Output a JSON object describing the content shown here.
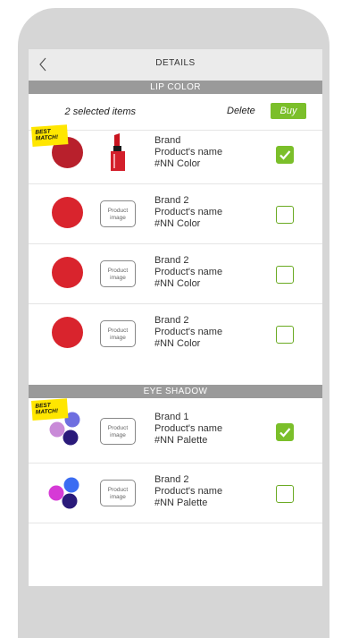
{
  "nav": {
    "title": "DETAILS",
    "back_icon": "chevron-left-icon"
  },
  "toolbar": {
    "selected_count": "2 selected items",
    "delete_label": "Delete",
    "buy_label": "Buy"
  },
  "colors": {
    "accent_green": "#7bbf2a",
    "badge_yellow": "#ffe600",
    "section_gray": "#9a9a9a"
  },
  "sections": [
    {
      "title": "LIP COLOR",
      "items": [
        {
          "best_match": "BEST MATCH!",
          "brand": "Brand",
          "product": "Product's name",
          "color": "#NN Color",
          "swatch": "#b8202c",
          "image_label": "",
          "has_lipstick": true,
          "checked": true
        },
        {
          "best_match": "",
          "brand": "Brand 2",
          "product": "Product's name",
          "color": "#NN Color",
          "swatch": "#d9242d",
          "image_label": "Product image",
          "has_lipstick": false,
          "checked": false
        },
        {
          "best_match": "",
          "brand": "Brand 2",
          "product": "Product's name",
          "color": "#NN Color",
          "swatch": "#d9242d",
          "image_label": "Product image",
          "has_lipstick": false,
          "checked": false
        },
        {
          "best_match": "",
          "brand": "Brand 2",
          "product": "Product's name",
          "color": "#NN Color",
          "swatch": "#d9242d",
          "image_label": "Product image",
          "has_lipstick": false,
          "checked": false
        }
      ]
    },
    {
      "title": "EYE SHADOW",
      "items": [
        {
          "best_match": "BEST MATCH!",
          "brand": "Brand 1",
          "product": "Product's name",
          "color": "#NN Palette",
          "palette": [
            "#6e6ee0",
            "#c98ad8",
            "#2a1a7a"
          ],
          "image_label": "Product image",
          "checked": true
        },
        {
          "best_match": "",
          "brand": "Brand 2",
          "product": "Product's name",
          "color": "#NN Palette",
          "palette": [
            "#3b6cf2",
            "#d63ad6",
            "#2a1a7a"
          ],
          "image_label": "Product image",
          "checked": false
        }
      ]
    }
  ]
}
